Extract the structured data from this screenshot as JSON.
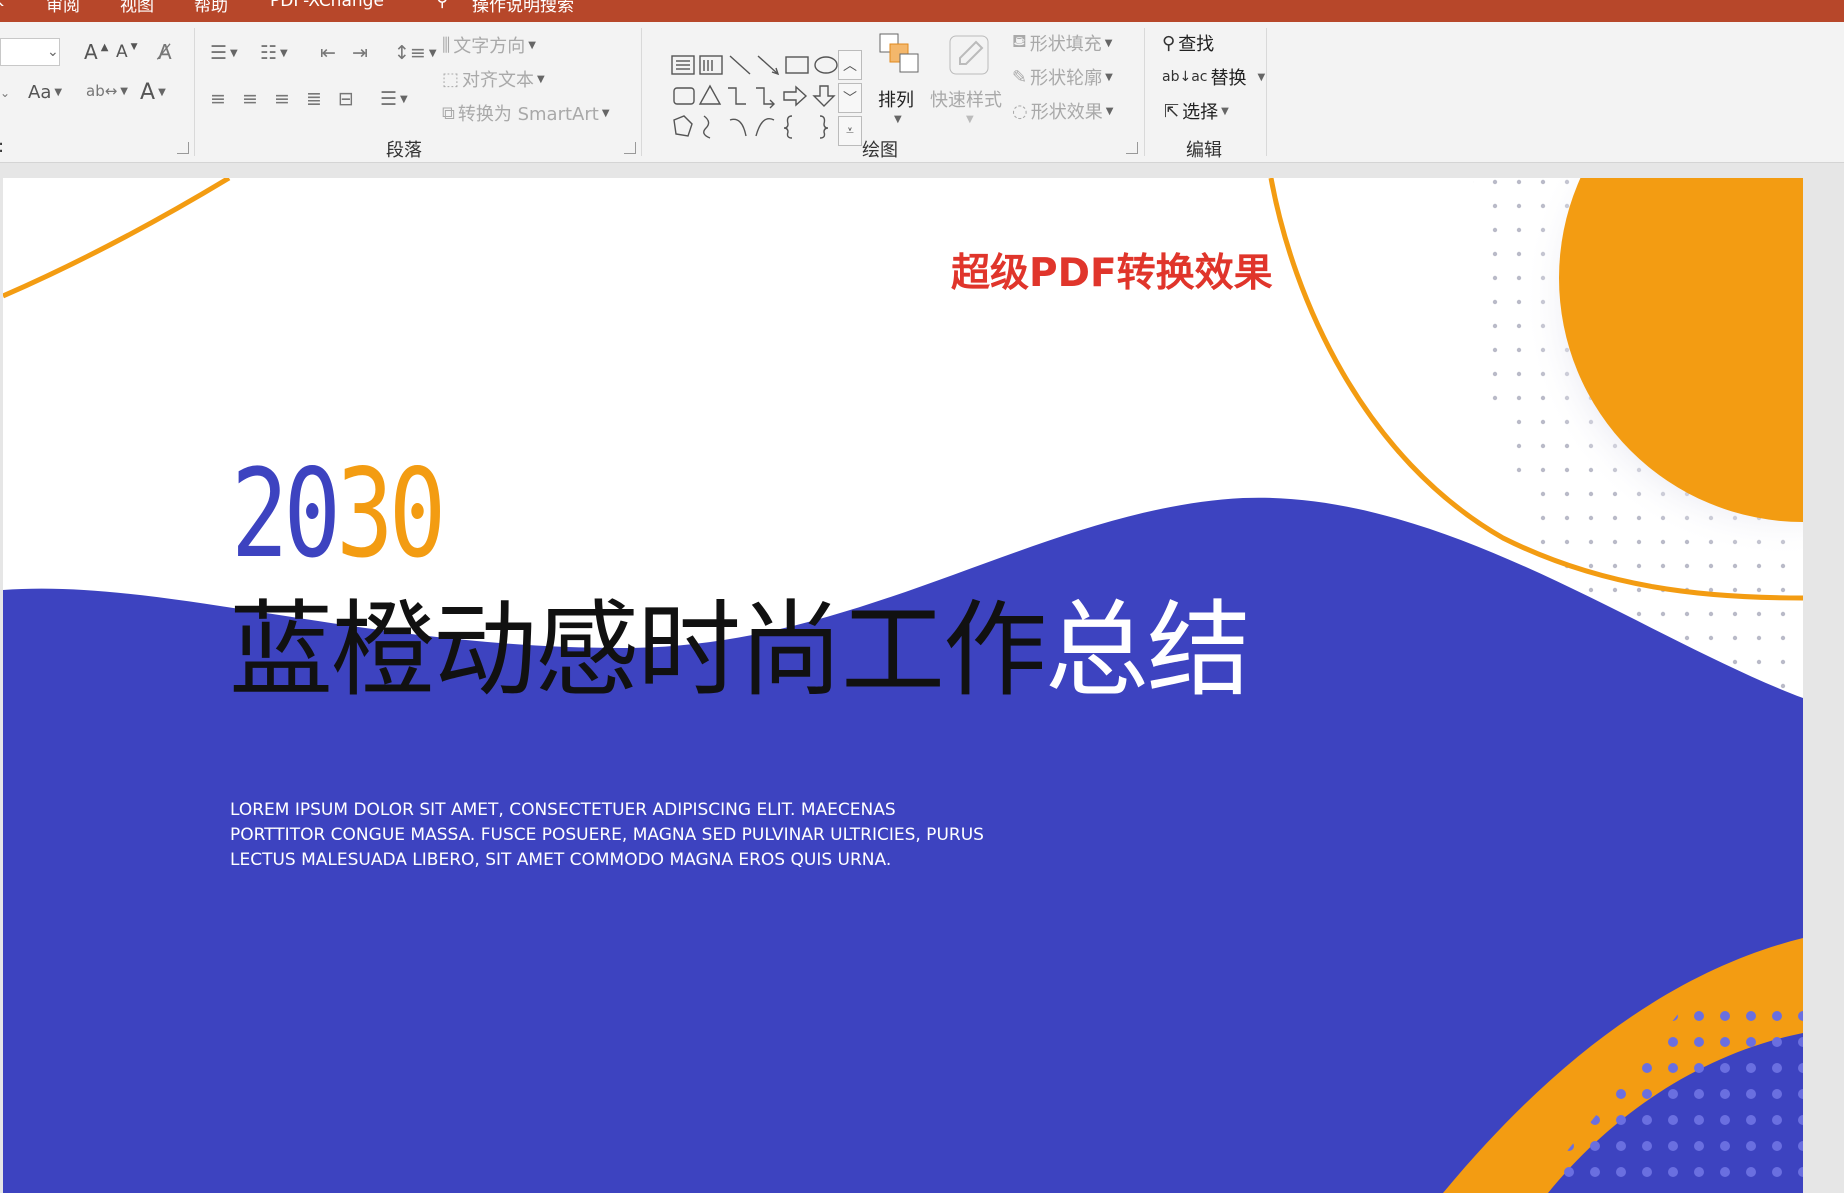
{
  "menu_tabs": [
    "审阅",
    "视图",
    "帮助",
    "PDF-XChange",
    "操作说明搜索"
  ],
  "ribbon": {
    "groups": {
      "paragraph": "段落",
      "drawing": "绘图",
      "editing": "编辑"
    },
    "font": {
      "size_value": "",
      "grow_label": "A",
      "shrink_label": "A",
      "case_label": "Aa",
      "font_color_label": "A"
    },
    "paragraph": {
      "text_direction": "文字方向",
      "align_text": "对齐文本",
      "convert_smartart": "转换为 SmartArt"
    },
    "drawing": {
      "arrange": "排列",
      "quick_styles": "快速样式",
      "shape_fill": "形状填充",
      "shape_outline": "形状轮廓",
      "shape_effects": "形状效果"
    },
    "editing": {
      "find": "查找",
      "replace": "替换",
      "select": "选择"
    }
  },
  "slide": {
    "watermark": "超级PDF转换效果",
    "year_part1": "20",
    "year_part2": "30",
    "headline_dark": "蓝橙动感时尚工作",
    "headline_white": "总结",
    "body": "LOREM IPSUM DOLOR SIT AMET, CONSECTETUER ADIPISCING ELIT. MAECENAS PORTTITOR CONGUE MASSA. FUSCE POSUERE, MAGNA SED PULVINAR ULTRICIES, PURUS LECTUS MALESUADA LIBERO, SIT AMET COMMODO MAGNA EROS QUIS URNA."
  },
  "colors": {
    "titlebar": "#b7472a",
    "blue": "#3d43c0",
    "orange": "#f39c12",
    "watermark": "#e0352b"
  }
}
